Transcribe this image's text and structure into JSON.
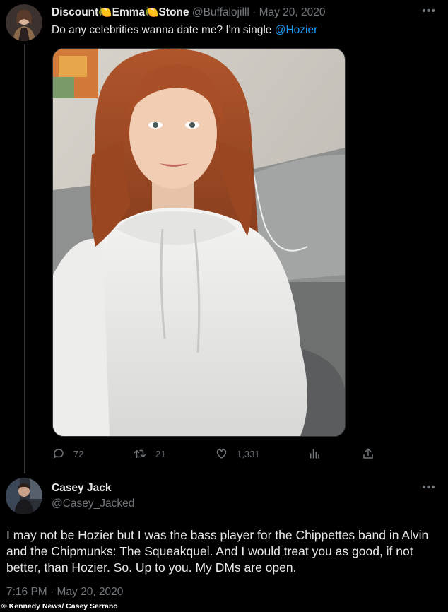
{
  "tweet": {
    "author": {
      "name_part1": "Discount",
      "name_part2": "Emma",
      "name_part3": "Stone",
      "lemon_emoji": "🍋",
      "handle": "@Buffalojilll",
      "separator": "·",
      "date": "May 20, 2020"
    },
    "text": "Do any celebrities wanna date me? I'm single ",
    "mention": "@Hozier",
    "more_icon": "more-horizontal-icon",
    "stats": {
      "replies": "72",
      "retweets": "21",
      "likes": "1,331"
    }
  },
  "reply": {
    "author": {
      "name": "Casey Jack",
      "handle": "@Casey_Jacked"
    },
    "text": "I may not be Hozier but I was the bass player for the Chippettes band in Alvin and the Chipmunks: The Squeakquel. And I would treat you as good, if not better, than Hozier. So. Up to you. My DMs are open.",
    "timestamp": "7:16 PM · May 20, 2020"
  },
  "credit": "© Kennedy News/ Casey Serrano",
  "colors": {
    "background": "#000000",
    "text": "#e7e9ea",
    "secondary": "#71767b",
    "accent": "#1d9bf0"
  }
}
